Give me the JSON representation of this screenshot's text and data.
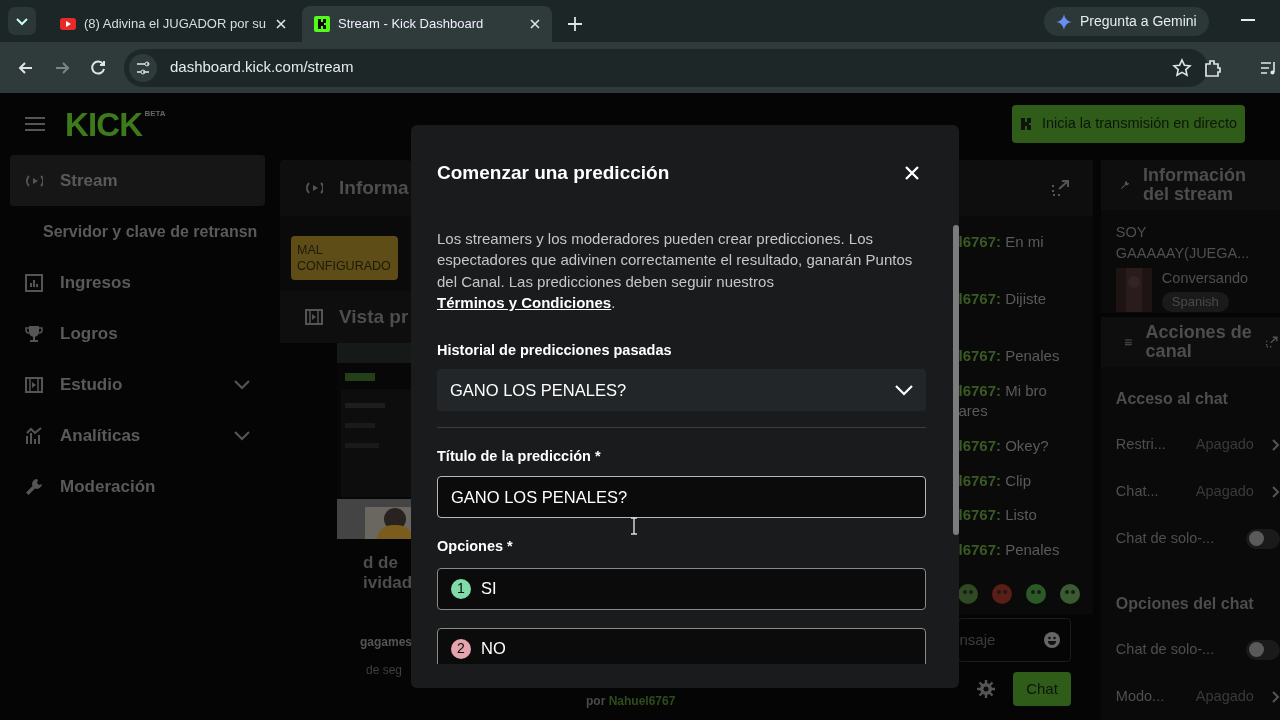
{
  "browser": {
    "tabs": [
      {
        "title": "(8) Adivina el JUGADOR por su",
        "kind": "youtube",
        "selected": false
      },
      {
        "title": "Stream - Kick Dashboard",
        "kind": "kick",
        "selected": true
      }
    ],
    "gemini_button": "Pregunta a Gemini",
    "url": "dashboard.kick.com/stream"
  },
  "header": {
    "logo": "KICK",
    "logo_badge": "BETA",
    "go_live_button": "Inicia la transmisión en directo"
  },
  "sidebar": {
    "items": [
      {
        "label": "Stream",
        "kind": "stream",
        "selected": true,
        "expandable": false
      },
      {
        "label": "Servidor y clave de retransn",
        "kind": "sub",
        "selected": false,
        "expandable": false
      },
      {
        "label": "Ingresos",
        "kind": "chart",
        "selected": false,
        "expandable": false
      },
      {
        "label": "Logros",
        "kind": "trophy",
        "selected": false,
        "expandable": false
      },
      {
        "label": "Estudio",
        "kind": "studio",
        "selected": false,
        "expandable": true
      },
      {
        "label": "Analíticas",
        "kind": "analytics",
        "selected": false,
        "expandable": true
      },
      {
        "label": "Moderación",
        "kind": "wrench",
        "selected": false,
        "expandable": false
      }
    ]
  },
  "stream_panel": {
    "title": "Informa",
    "status_badge": "MAL CONFIGURADO"
  },
  "preview_panel": {
    "title": "Vista pr",
    "heading_lines": [
      "d de",
      "ividad"
    ],
    "subtitle": "gagames",
    "caption": "de seg",
    "byline_prefix": "por",
    "byline_user": "Nahuel6767"
  },
  "modal": {
    "title": "Comenzar una predicción",
    "description": "Los streamers y los moderadores pueden crear predicciones. Los espectadores que adivinen correctamente el resultado, ganarán Puntos del Canal. Las predicciones deben seguir nuestros",
    "terms_link": "Términos y Condiciones",
    "terms_end": ".",
    "history_label": "Historial de predicciones pasadas",
    "history_value": "GANO LOS PENALES?",
    "title_label": "Título de la predicción *",
    "title_value": "GANO LOS PENALES?",
    "options_label": "Opciones *",
    "options": [
      {
        "number": "1",
        "text": "SI",
        "color": "#7fdca8"
      },
      {
        "number": "2",
        "text": "NO",
        "color": "#e3a4ab"
      }
    ]
  },
  "chat": {
    "messages": [
      {
        "user": "l6767:",
        "text": "En mi"
      },
      {
        "user": "l6767:",
        "text": "Dijiste"
      },
      {
        "user": "l6767:",
        "text": "Penales"
      },
      {
        "user": "l6767:",
        "text": "Mi bro",
        "continuation": "ares"
      },
      {
        "user": "l6767:",
        "text": "Okey?"
      },
      {
        "user": "l6767:",
        "text": "Clip"
      },
      {
        "user": "l6767:",
        "text": "Listo"
      },
      {
        "user": "l6767:",
        "text": "Penales"
      }
    ],
    "input_placeholder": "nsaje",
    "send_button": "Chat"
  },
  "stream_info": {
    "title": "Información del stream",
    "stream_title": "SOY GAAAAAY(JUEGA...",
    "category": "Conversando",
    "tag": "Spanish"
  },
  "channel_actions": {
    "title": "Acciones de canal",
    "sections": [
      {
        "title": "Acceso al chat",
        "rows": [
          {
            "kind": "select",
            "label": "Restri...",
            "value": "Apagado"
          },
          {
            "kind": "select",
            "label": "Chat...",
            "value": "Apagado"
          },
          {
            "kind": "toggle",
            "label": "Chat de solo-...",
            "on": false
          }
        ]
      },
      {
        "title": "Opciones del chat",
        "rows": [
          {
            "kind": "toggle",
            "label": "Chat de solo-...",
            "on": false
          },
          {
            "kind": "select",
            "label": "Modo...",
            "value": "Apagado"
          }
        ]
      }
    ]
  }
}
